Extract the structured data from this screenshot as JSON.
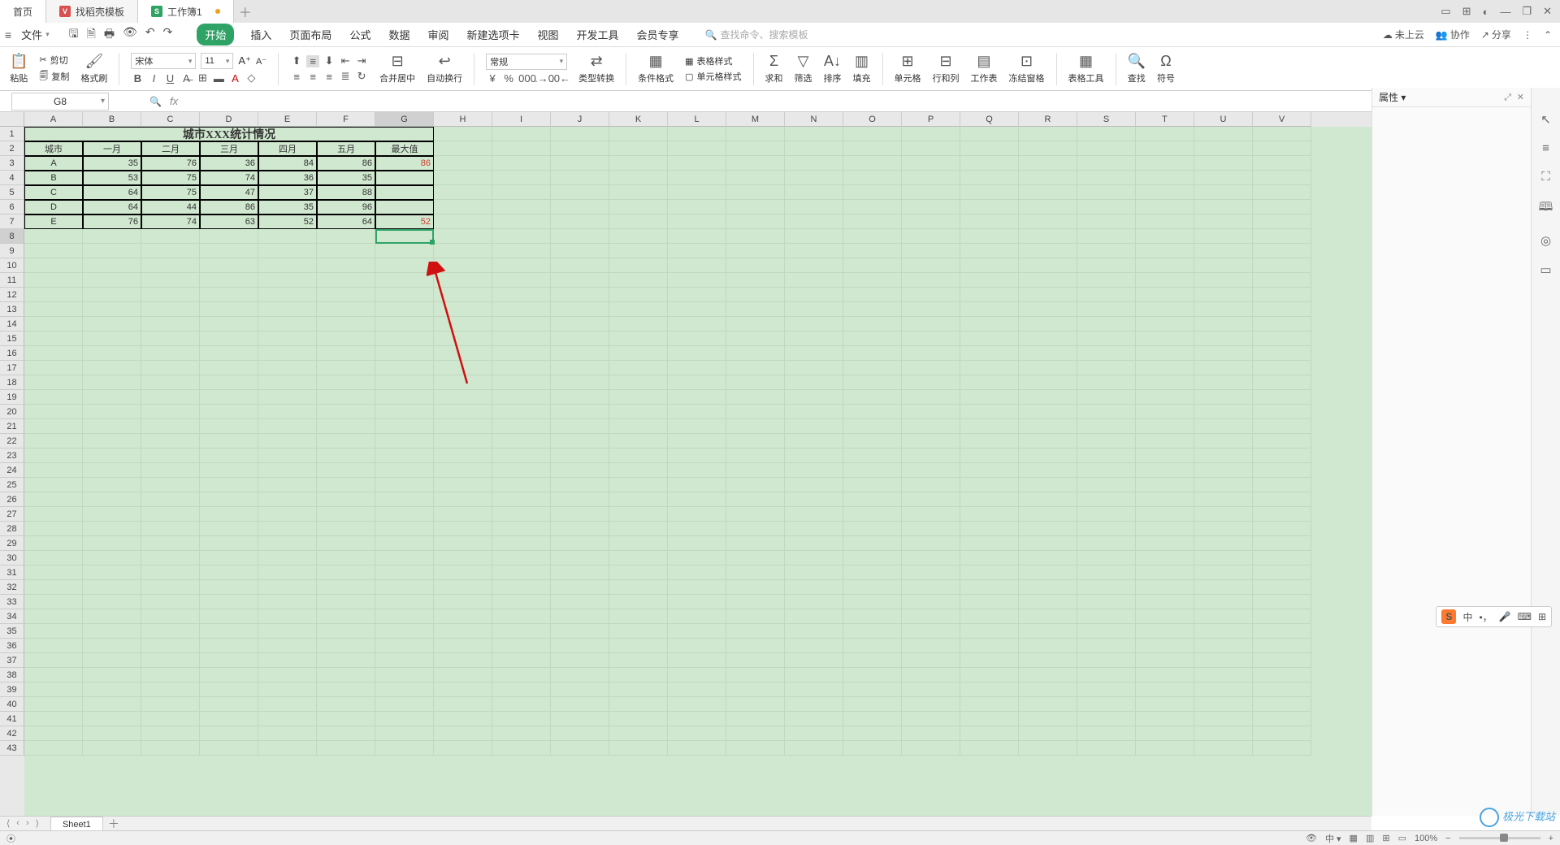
{
  "tabs": {
    "home": "首页",
    "template": "找稻壳模板",
    "workbook": "工作簿1"
  },
  "window": {
    "cloud": "未上云",
    "collab": "协作",
    "share": "分享"
  },
  "menu": {
    "file": "文件",
    "tabs": [
      "开始",
      "插入",
      "页面布局",
      "公式",
      "数据",
      "审阅",
      "新建选项卡",
      "视图",
      "开发工具",
      "会员专享"
    ],
    "search_placeholder": "查找命令、搜索模板"
  },
  "ribbon": {
    "paste": "粘贴",
    "cut": "剪切",
    "copy": "复制",
    "fmt_painter": "格式刷",
    "font_name": "宋体",
    "font_size": "11",
    "merge": "合并居中",
    "wrap": "自动换行",
    "number_fmt": "常规",
    "type_conv": "类型转换",
    "cond_fmt": "条件格式",
    "table_style": "表格样式",
    "cell_style": "单元格样式",
    "sum": "求和",
    "filter": "筛选",
    "sort": "排序",
    "fill": "填充",
    "cell": "单元格",
    "rowcol": "行和列",
    "sheet": "工作表",
    "freeze": "冻结窗格",
    "table_tools": "表格工具",
    "find": "查找",
    "symbol": "符号"
  },
  "name_box": "G8",
  "properties_label": "属性",
  "columns": [
    "A",
    "B",
    "C",
    "D",
    "E",
    "F",
    "G",
    "H",
    "I",
    "J",
    "K",
    "L",
    "M",
    "N",
    "O",
    "P",
    "Q",
    "R",
    "S",
    "T",
    "U",
    "V"
  ],
  "sheet": {
    "title": "城市XXX统计情况",
    "headers": [
      "城市",
      "一月",
      "二月",
      "三月",
      "四月",
      "五月",
      "最大值"
    ],
    "rows": [
      [
        "A",
        "35",
        "76",
        "36",
        "84",
        "86",
        "86"
      ],
      [
        "B",
        "53",
        "75",
        "74",
        "36",
        "35",
        ""
      ],
      [
        "C",
        "64",
        "75",
        "47",
        "37",
        "88",
        ""
      ],
      [
        "D",
        "64",
        "44",
        "86",
        "35",
        "96",
        ""
      ],
      [
        "E",
        "76",
        "74",
        "63",
        "52",
        "64",
        "52"
      ]
    ],
    "max_color": "#d04030"
  },
  "sheet_tab": "Sheet1",
  "status": {
    "zoom": "100%"
  },
  "ime": {
    "lang": "中"
  },
  "watermark": "极光下载站"
}
